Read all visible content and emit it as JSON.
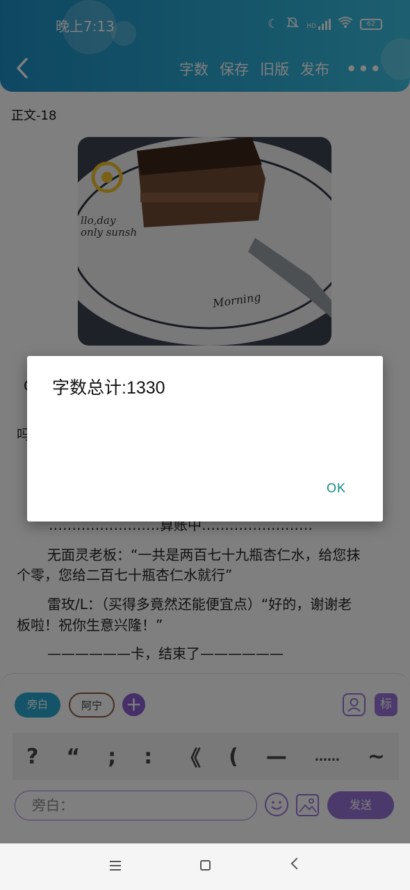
{
  "status_bar": {
    "time": "晚上7:13",
    "hd_label": "HD",
    "battery": "62"
  },
  "toolbar": {
    "word_count": "字数",
    "save": "保存",
    "old_version": "旧版",
    "publish": "发布"
  },
  "chapter_title": "正文-18",
  "photo": {
    "plate_text_1": "llo,day",
    "plate_text_2": "only sunsh",
    "plate_text_3": "Morning"
  },
  "content": {
    "partial_left_1": "C",
    "partial_left_2": "吗",
    "line_settling": "……………………算账中……………………",
    "line_boss_1": "无面灵老板：“一共是两百七十九瓶杏仁水，给您抹",
    "line_boss_2": "个零，您给二百七十瓶杏仁水就行”",
    "line_lei_1": "雷玫/L：（买得多竟然还能便宜点）“好的，谢谢老",
    "line_lei_2": "板啦！祝你生意兴隆！”",
    "line_end": "——————卡，结束了——————"
  },
  "composer": {
    "chip_narration": "旁白",
    "chip_character": "阿宁",
    "add_symbol": "+",
    "tag_label": "标",
    "punctuation": [
      "?",
      "“",
      ";",
      ":",
      "《",
      "(",
      "—",
      "……",
      "~"
    ],
    "input_value": "旁白：",
    "send_label": "发送"
  },
  "dialog": {
    "message": "字数总计:1330",
    "ok_label": "OK"
  },
  "colors": {
    "header_start": "#1d8fc4",
    "accent_purple": "#9673d6",
    "accent_blue": "#2aa9d1",
    "ok_teal": "#0b8a87"
  }
}
